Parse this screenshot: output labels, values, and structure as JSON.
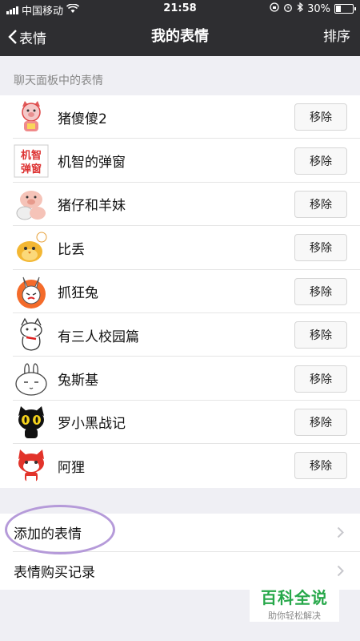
{
  "status_bar": {
    "carrier": "中国移动",
    "time": "21:58",
    "battery": "30%",
    "battery_level": 0.3
  },
  "nav": {
    "back_label": "表情",
    "title": "我的表情",
    "right_action": "排序"
  },
  "section_title": "聊天面板中的表情",
  "stickers": [
    {
      "name": "猪傻傻2",
      "action": "移除",
      "icon": "pig-cat-sticker-icon"
    },
    {
      "name": "机智的弹窗",
      "action": "移除",
      "icon": "popup-text-sticker-icon",
      "icon_text": "机智弹窗"
    },
    {
      "name": "猪仔和羊妹",
      "action": "移除",
      "icon": "pig-sheep-sticker-icon"
    },
    {
      "name": "比丢",
      "action": "移除",
      "icon": "yellow-chick-sticker-icon"
    },
    {
      "name": "抓狂兔",
      "action": "移除",
      "icon": "angry-rabbit-sticker-icon"
    },
    {
      "name": "有三人校园篇",
      "action": "移除",
      "icon": "white-cat-sticker-icon"
    },
    {
      "name": "兔斯基",
      "action": "移除",
      "icon": "tuzki-sticker-icon"
    },
    {
      "name": "罗小黑战记",
      "action": "移除",
      "icon": "black-cat-sticker-icon"
    },
    {
      "name": "阿狸",
      "action": "移除",
      "icon": "red-fox-sticker-icon"
    }
  ],
  "menu": [
    {
      "label": "添加的表情"
    },
    {
      "label": "表情购买记录"
    }
  ],
  "watermark": {
    "title": "百科全说",
    "subtitle": "助你轻松解决"
  },
  "colors": {
    "nav_bg": "#2e2e31",
    "page_bg": "#efeff4",
    "highlight": "#b59ad9",
    "watermark_green": "#27a84a"
  }
}
